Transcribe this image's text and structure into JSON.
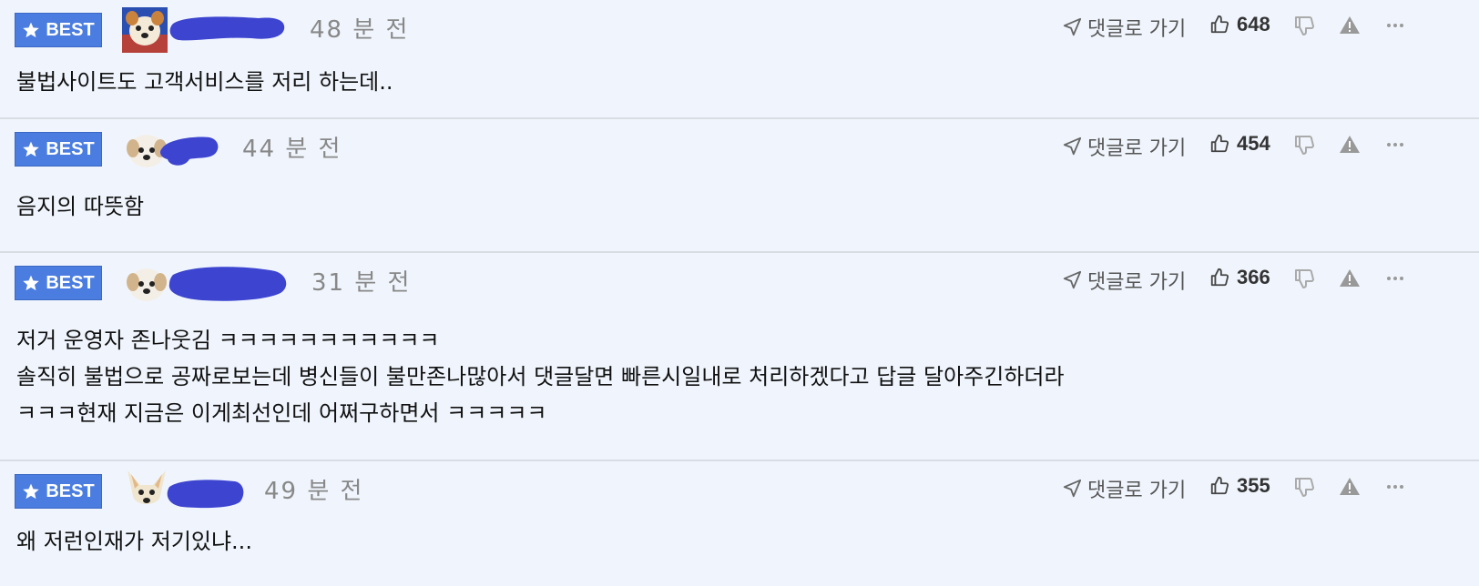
{
  "labels": {
    "best": "BEST",
    "goto": "댓글로 가기"
  },
  "colors": {
    "background": "#f0f5fd",
    "best_badge": "#4a7ddf",
    "redaction": "#3c44d0"
  },
  "icons": {
    "best": "star-icon",
    "goto": "send-arrow-icon",
    "like": "thumbs-up-icon",
    "dislike": "thumbs-down-icon",
    "report": "warning-icon",
    "more": "more-dots-icon"
  },
  "comments": [
    {
      "time": "48 분 전",
      "likes": "648",
      "body": "불법사이트도 고객서비스를 저리 하는데.."
    },
    {
      "time": "44 분 전",
      "likes": "454",
      "body": "음지의 따뜻함"
    },
    {
      "time": "31 분 전",
      "likes": "366",
      "body": "저거 운영자 존나웃김 ㅋㅋㅋㅋㅋㅋㅋㅋㅋㅋㅋ\n솔직히 불법으로 공짜로보는데 병신들이 불만존나많아서 댓글달면 빠른시일내로 처리하겠다고 답글 달아주긴하더라\nㅋㅋㅋ현재 지금은 이게최선인데 어쩌구하면서 ㅋㅋㅋㅋㅋ"
    },
    {
      "time": "49 분 전",
      "likes": "355",
      "body": "왜 저런인재가 저기있냐..."
    }
  ]
}
